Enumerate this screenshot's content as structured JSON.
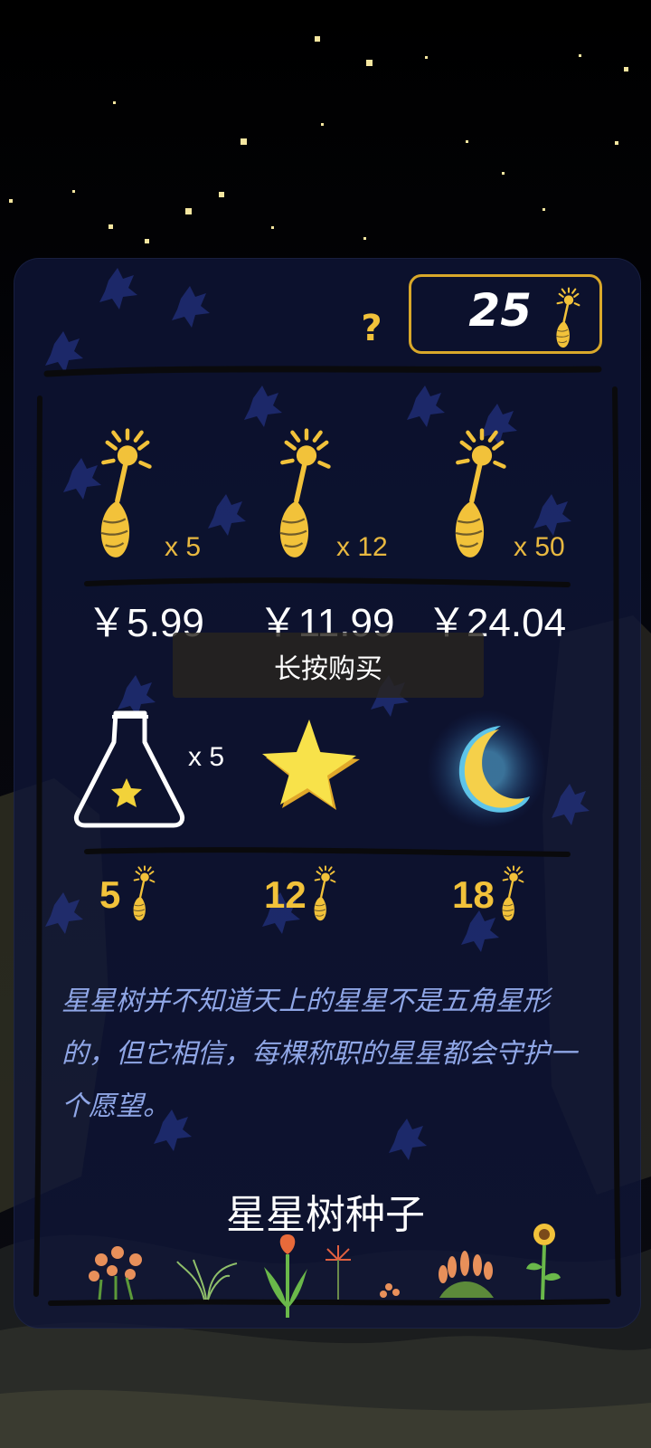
{
  "balance": {
    "value": "25",
    "icon": "seed-icon"
  },
  "help_label": "?",
  "packs": [
    {
      "quantity": "x 5",
      "price": "￥5.99",
      "icon": "seed-icon"
    },
    {
      "quantity": "x 12",
      "price": "￥11.99",
      "icon": "seed-icon"
    },
    {
      "quantity": "x 50",
      "price": "￥24.04",
      "icon": "seed-icon"
    }
  ],
  "hint": "长按购买",
  "items": [
    {
      "name_icon": "potion-flask-icon",
      "quantity": "x 5",
      "cost": "5",
      "cost_icon": "seed-icon"
    },
    {
      "name_icon": "star-icon",
      "quantity": "",
      "cost": "12",
      "cost_icon": "seed-icon"
    },
    {
      "name_icon": "crescent-moon-icon",
      "quantity": "",
      "cost": "18",
      "cost_icon": "seed-icon"
    }
  ],
  "description": "星星树并不知道天上的星星不是五角星形的，但它相信，每棵称职的星星都会守护一个愿望。",
  "title": "星星树种子",
  "colors": {
    "accent": "#f2c23a",
    "description": "#8fa6e6",
    "panel": "#101638"
  }
}
